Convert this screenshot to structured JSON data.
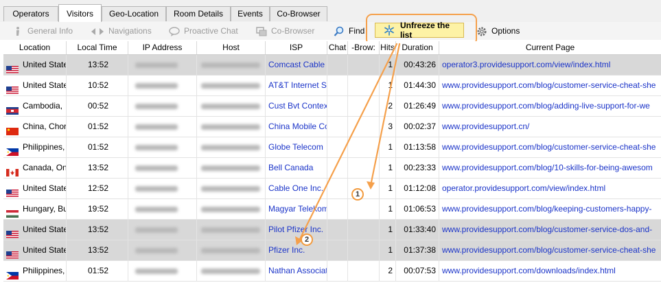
{
  "tabs": [
    {
      "label": "Operators",
      "active": false
    },
    {
      "label": "Visitors",
      "active": true
    },
    {
      "label": "Geo-Location",
      "active": false
    },
    {
      "label": "Room Details",
      "active": false
    },
    {
      "label": "Events",
      "active": false
    },
    {
      "label": "Co-Browser",
      "active": false
    }
  ],
  "toolbar": {
    "general_info": "General Info",
    "navigations": "Navigations",
    "proactive_chat": "Proactive Chat",
    "co_browser": "Co-Browser",
    "find": "Find",
    "unfreeze": "Unfreeze the list",
    "options": "Options"
  },
  "columns": [
    "Location",
    "Local Time",
    "IP Address",
    "Host",
    "ISP",
    "Chat",
    "-Brow:",
    "Hits",
    "Duration",
    "Current Page"
  ],
  "rows": [
    {
      "flag": "us",
      "location": "United State",
      "time": "13:52",
      "isp": "Comcast Cable C",
      "hits": "1",
      "duration": "00:43:26",
      "page": "operator3.providesupport.com/view/index.html",
      "selected": true
    },
    {
      "flag": "us",
      "location": "United State",
      "time": "10:52",
      "isp": "AT&T Internet Se",
      "hits": "1",
      "duration": "01:44:30",
      "page": "www.providesupport.com/blog/customer-service-cheat-she",
      "selected": false
    },
    {
      "flag": "kh",
      "location": "Cambodia,",
      "time": "00:52",
      "isp": "Cust Bvt Contex",
      "hits": "2",
      "duration": "01:26:49",
      "page": "www.providesupport.com/blog/adding-live-support-for-we",
      "selected": false
    },
    {
      "flag": "cn",
      "location": "China, Chor",
      "time": "01:52",
      "isp": "China Mobile Co",
      "hits": "3",
      "duration": "00:02:37",
      "page": "www.providesupport.cn/",
      "selected": false
    },
    {
      "flag": "ph",
      "location": "Philippines,",
      "time": "01:52",
      "isp": "Globe Telecom",
      "hits": "1",
      "duration": "01:13:58",
      "page": "www.providesupport.com/blog/customer-service-cheat-she",
      "selected": false
    },
    {
      "flag": "ca",
      "location": "Canada, On",
      "time": "13:52",
      "isp": "Bell Canada",
      "hits": "1",
      "duration": "00:23:33",
      "page": "www.providesupport.com/blog/10-skills-for-being-awesom",
      "selected": false
    },
    {
      "flag": "us",
      "location": "United State",
      "time": "12:52",
      "isp": "Cable One Inc.",
      "hits": "1",
      "duration": "01:12:08",
      "page": "operator.providesupport.com/view/index.html",
      "selected": false
    },
    {
      "flag": "hu",
      "location": "Hungary, Bu",
      "time": "19:52",
      "isp": "Magyar Telekom",
      "hits": "1",
      "duration": "01:06:53",
      "page": "www.providesupport.com/blog/keeping-customers-happy-",
      "selected": false
    },
    {
      "flag": "us",
      "location": "United State",
      "time": "13:52",
      "isp": "Pilot Pfizer Inc.",
      "hits": "1",
      "duration": "01:33:40",
      "page": "www.providesupport.com/blog/customer-service-dos-and-",
      "selected": true
    },
    {
      "flag": "us",
      "location": "United State",
      "time": "13:52",
      "isp": "Pfizer Inc.",
      "hits": "1",
      "duration": "01:37:38",
      "page": "www.providesupport.com/blog/customer-service-cheat-she",
      "selected": true
    },
    {
      "flag": "ph",
      "location": "Philippines,",
      "time": "01:52",
      "isp": "Nathan Associat",
      "hits": "2",
      "duration": "00:07:53",
      "page": "www.providesupport.com/downloads/index.html",
      "selected": false
    }
  ],
  "callouts": [
    "1",
    "2"
  ],
  "colors": {
    "accent": "#f5a04b",
    "link": "#1a33c8",
    "highlight": "#fdf2a6"
  }
}
